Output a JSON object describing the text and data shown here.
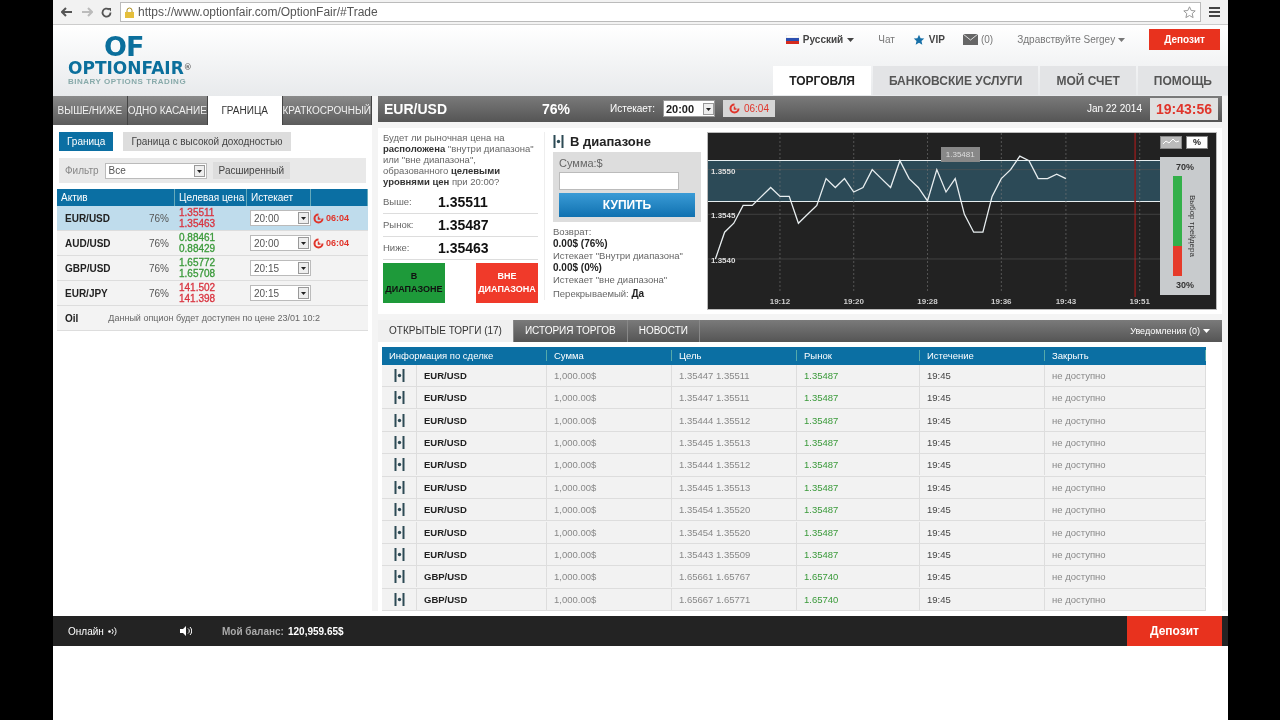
{
  "browser": {
    "url": "https://www.optionfair.com/OptionFair/#Trade"
  },
  "header": {
    "logo": {
      "mark": "OF",
      "name": "OPTIONFAIR",
      "registered": "®",
      "tagline": "BINARY OPTIONS TRADING"
    },
    "language": "Русский",
    "chat": "Чат",
    "vip": "VIP",
    "messages": "(0)",
    "greeting": "Здравствуйте Sergey",
    "deposit": "Депозит",
    "nav": [
      {
        "label": "ТОРГОВЛЯ",
        "selected": true
      },
      {
        "label": "БАНКОВСКИЕ УСЛУГИ",
        "selected": false
      },
      {
        "label": "МОЙ СЧЕТ",
        "selected": false
      },
      {
        "label": "ПОМОЩЬ",
        "selected": false
      }
    ]
  },
  "left_panel": {
    "tabs": [
      {
        "label": "ВЫШЕ/НИЖЕ",
        "selected": false
      },
      {
        "label": "ОДНО КАСАНИЕ",
        "selected": false
      },
      {
        "label": "ГРАНИЦА",
        "selected": true
      },
      {
        "label": "КРАТКОСРОЧНЫЙ",
        "selected": false
      }
    ],
    "subtabs": [
      {
        "label": "Граница",
        "selected": true
      },
      {
        "label": "Граница с высокой доходностью",
        "selected": false
      }
    ],
    "filter": {
      "label": "Фильтр",
      "value": "Все",
      "advanced": "Расширенный"
    },
    "columns": [
      "Актив",
      "Целевая цена",
      "Истекает"
    ],
    "rows": [
      {
        "kind": "asset",
        "asset": "EUR/USD",
        "payout": "76%",
        "high": "1.35511",
        "low": "1.35463",
        "color": "#d9333f",
        "expiry": "20:00",
        "timer": "06:04",
        "selected": true
      },
      {
        "kind": "asset",
        "asset": "AUD/USD",
        "payout": "76%",
        "high": "0.88461",
        "low": "0.88429",
        "color": "#3a9a3a",
        "expiry": "20:00",
        "timer": "06:04",
        "selected": false
      },
      {
        "kind": "asset",
        "asset": "GBP/USD",
        "payout": "76%",
        "high": "1.65772",
        "low": "1.65708",
        "color": "#3a9a3a",
        "expiry": "20:15",
        "selected": false
      },
      {
        "kind": "asset",
        "asset": "EUR/JPY",
        "payout": "76%",
        "high": "141.502",
        "low": "141.398",
        "color": "#d9333f",
        "expiry": "20:15",
        "selected": false
      },
      {
        "kind": "unavailable",
        "asset": "Oil",
        "message": "Данный опцион будет доступен по цене 23/01 10:2"
      }
    ]
  },
  "trade": {
    "asset": "EUR/USD",
    "payout": "76%",
    "expires_label": "Истекает:",
    "expiry": "20:00",
    "timer": "06:04",
    "date": "Jan 22 2014",
    "clock": "19:43:56",
    "question": "Будет ли рыночная цена на **расположена** \"внутри диапазона\" или \"вне диапазона\", образованного **целевыми уровнями цен** при 20:00?",
    "prices": [
      {
        "label": "Выше:",
        "value": "1.35511"
      },
      {
        "label": "Рынок:",
        "value": "1.35487"
      },
      {
        "label": "Ниже:",
        "value": "1.35463"
      }
    ],
    "in_button": "В ДИАПАЗОНЕ",
    "out_button": "ВНЕ ДИАПАЗОНА",
    "order": {
      "title": "В диапазоне",
      "amount_label": "Сумма:$",
      "buy": "КУПИТЬ",
      "return_label": "Возврат:",
      "in_return": "0.00$ (76%)",
      "in_note": "Истекает \"Внутри диапазона\"",
      "out_return": "0.00$ (0%)",
      "out_note": "Истекает \"вне диапазона\"",
      "overlap": "Перекрываемый: **Да**"
    },
    "chart_data": {
      "type": "line",
      "categories": [
        null,
        null,
        null,
        null,
        null,
        null,
        null,
        "19:12",
        null,
        null,
        null,
        null,
        null,
        null,
        null,
        "19:20",
        null,
        null,
        null,
        null,
        null,
        null,
        null,
        "19:28",
        null,
        null,
        null,
        null,
        null,
        null,
        null,
        "19:36",
        null,
        null,
        null,
        null,
        null,
        null,
        "19:43",
        null,
        null,
        null,
        null,
        null,
        null,
        null,
        "19:51",
        null,
        null
      ],
      "series": [
        {
          "color": "#e8eef0",
          "values": [
            1.354,
            1.3543,
            1.3544,
            1.3546,
            1.3546,
            1.3547,
            1.3548,
            1.3547,
            1.3547,
            1.3544,
            1.3545,
            1.3546,
            1.3549,
            1.3548,
            1.3549,
            1.35475,
            1.3548,
            1.355,
            1.3549,
            1.3548,
            1.3551,
            1.3549,
            1.3548,
            1.35465,
            1.355,
            1.35475,
            1.3549,
            1.3545,
            1.3543,
            1.3543,
            1.3547,
            1.3549,
            1.355,
            1.35515,
            1.3551,
            1.3549,
            1.3549,
            1.35495,
            1.3549,
            null,
            null,
            null,
            null,
            null,
            null,
            null,
            null,
            null,
            null
          ]
        }
      ],
      "ylim": [
        1.35344,
        1.35541
      ],
      "grid": true,
      "yticks": [
        {
          "value": 1.355,
          "label": "1.3550"
        },
        {
          "value": 1.3545,
          "label": "1.3545"
        },
        {
          "value": 1.354,
          "label": "1.3540"
        }
      ],
      "annotations": [
        "1.35481"
      ]
    },
    "percent_button": "%",
    "sentiment": {
      "title": "Выбор трейдера",
      "up": "70%",
      "down": "30%",
      "level": 0.7
    }
  },
  "trades": {
    "tabs": [
      {
        "label": "ОТКРЫТЫЕ ТОРГИ (17)",
        "selected": true
      },
      {
        "label": "ИСТОРИЯ ТОРГОВ",
        "selected": false
      },
      {
        "label": "НОВОСТИ",
        "selected": false
      }
    ],
    "notifications": "Уведомления (0)",
    "columns": [
      "Информация по сделке",
      "Сумма",
      "Цель",
      "Рынок",
      "Истечение",
      "Закрыть"
    ],
    "rows": [
      {
        "asset": "EUR/USD",
        "amount": "1,000.00$",
        "target": "1.35447 1.35511",
        "market": "1.35487",
        "expiry": "19:45",
        "close": "не доступно"
      },
      {
        "asset": "EUR/USD",
        "amount": "1,000.00$",
        "target": "1.35447 1.35511",
        "market": "1.35487",
        "expiry": "19:45",
        "close": "не доступно"
      },
      {
        "asset": "EUR/USD",
        "amount": "1,000.00$",
        "target": "1.35444 1.35512",
        "market": "1.35487",
        "expiry": "19:45",
        "close": "не доступно"
      },
      {
        "asset": "EUR/USD",
        "amount": "1,000.00$",
        "target": "1.35445 1.35513",
        "market": "1.35487",
        "expiry": "19:45",
        "close": "не доступно"
      },
      {
        "asset": "EUR/USD",
        "amount": "1,000.00$",
        "target": "1.35444 1.35512",
        "market": "1.35487",
        "expiry": "19:45",
        "close": "не доступно"
      },
      {
        "asset": "EUR/USD",
        "amount": "1,000.00$",
        "target": "1.35445 1.35513",
        "market": "1.35487",
        "expiry": "19:45",
        "close": "не доступно"
      },
      {
        "asset": "EUR/USD",
        "amount": "1,000.00$",
        "target": "1.35454 1.35520",
        "market": "1.35487",
        "expiry": "19:45",
        "close": "не доступно"
      },
      {
        "asset": "EUR/USD",
        "amount": "1,000.00$",
        "target": "1.35454 1.35520",
        "market": "1.35487",
        "expiry": "19:45",
        "close": "не доступно"
      },
      {
        "asset": "EUR/USD",
        "amount": "1,000.00$",
        "target": "1.35443 1.35509",
        "market": "1.35487",
        "expiry": "19:45",
        "close": "не доступно"
      },
      {
        "asset": "GBP/USD",
        "amount": "1,000.00$",
        "target": "1.65661 1.65767",
        "market": "1.65740",
        "expiry": "19:45",
        "close": "не доступно"
      },
      {
        "asset": "GBP/USD",
        "amount": "1,000.00$",
        "target": "1.65667 1.65771",
        "market": "1.65740",
        "expiry": "19:45",
        "close": "не доступно"
      }
    ]
  },
  "footer": {
    "status": "Онлайн",
    "balance_label": "Мой баланс:",
    "balance": "120,959.65$",
    "deposit": "Депозит"
  }
}
